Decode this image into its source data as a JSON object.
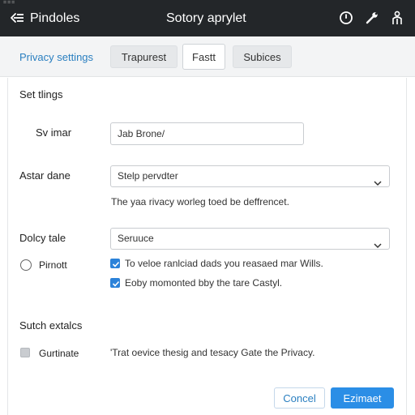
{
  "window": {
    "corner_text": "===",
    "app_name": "Pindoles",
    "title": "Sotory aprylet",
    "icons": [
      "menu-back-icon",
      "clock-icon",
      "wrench-icon",
      "person-icon"
    ]
  },
  "tabs": {
    "link_label": "Privacy settings",
    "items": [
      {
        "label": "Trapurest"
      },
      {
        "label": "Fastt",
        "active": true
      },
      {
        "label": "Subices"
      }
    ]
  },
  "form": {
    "section_settings": "Set tlings",
    "similar_label": "Sv imar",
    "similar_value": "Jab Brone/",
    "astar_label": "Astar dane",
    "astar_value": "Stelp pervdter",
    "help_text": "The yaa rivacy worleg toed be deffrencet.",
    "dotcy_label": "Dolcy tale",
    "dotcy_value": "Seruuce",
    "radio_label": "Pirnott",
    "check1_label": "To veloe ranlciad dads you reasaed mar Wills.",
    "check2_label": "Eoby momonted bby the tare Castyl.",
    "section_switch": "Sutch extalcs",
    "unchecked_label": "Gurtinate",
    "unchecked_text": "'Trat oevice thesig and tesacy Gate the Privacy."
  },
  "footer": {
    "cancel_label": "Concel",
    "primary_label": "Ezimaet"
  },
  "colors": {
    "titlebar_bg": "#232629",
    "accent": "#2b8ee6",
    "link": "#2a7fc0"
  }
}
